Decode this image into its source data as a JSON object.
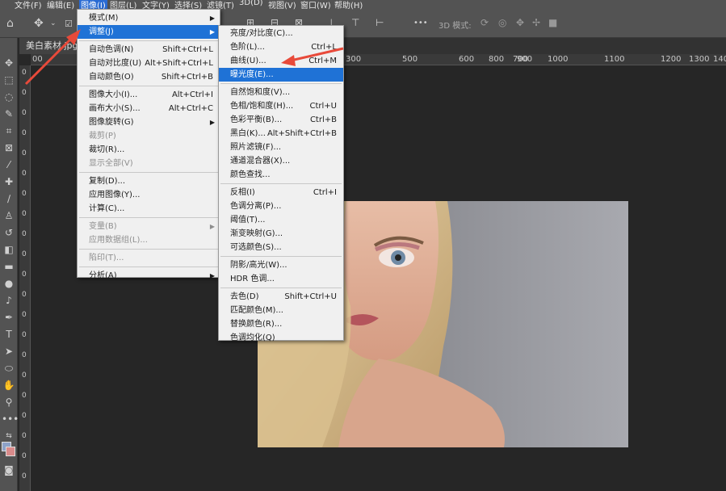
{
  "menubar": {
    "items": [
      "文件(F)",
      "编辑(E)",
      "图像(I)",
      "图层(L)",
      "文字(Y)",
      "选择(S)",
      "滤镜(T)",
      "3D(D)",
      "视图(V)",
      "窗口(W)",
      "帮助(H)"
    ]
  },
  "optbar": {
    "mode_3d": "3D 模式:",
    "dots": "•••"
  },
  "document": {
    "tab_title": "美白素材.jpg"
  },
  "ruler": {
    "top": [
      "00",
      "300",
      "500",
      "600",
      "700",
      "800",
      "900",
      "1000",
      "1100",
      "1200",
      "1300",
      "1400"
    ],
    "left": [
      "0",
      "0",
      "0",
      "0",
      "0",
      "0",
      "0",
      "0",
      "0",
      "0",
      "0",
      "0",
      "0",
      "0",
      "0",
      "0",
      "0",
      "0",
      "0",
      "0",
      "0"
    ]
  },
  "image_menu": {
    "items": [
      {
        "label": "模式(M)",
        "shortcut": "",
        "submenu": true
      },
      {
        "label": "调整(J)",
        "shortcut": "",
        "submenu": true,
        "highlighted": true
      },
      {
        "label": "自动色调(N)",
        "shortcut": "Shift+Ctrl+L"
      },
      {
        "label": "自动对比度(U)",
        "shortcut": "Alt+Shift+Ctrl+L"
      },
      {
        "label": "自动颜色(O)",
        "shortcut": "Shift+Ctrl+B"
      },
      {
        "label": "图像大小(I)...",
        "shortcut": "Alt+Ctrl+I"
      },
      {
        "label": "画布大小(S)...",
        "shortcut": "Alt+Ctrl+C"
      },
      {
        "label": "图像旋转(G)",
        "shortcut": "",
        "submenu": true
      },
      {
        "label": "裁剪(P)",
        "shortcut": "",
        "disabled": true
      },
      {
        "label": "裁切(R)...",
        "shortcut": ""
      },
      {
        "label": "显示全部(V)",
        "shortcut": "",
        "disabled": true
      },
      {
        "label": "复制(D)...",
        "shortcut": ""
      },
      {
        "label": "应用图像(Y)...",
        "shortcut": ""
      },
      {
        "label": "计算(C)...",
        "shortcut": ""
      },
      {
        "label": "变量(B)",
        "shortcut": "",
        "submenu": true,
        "disabled": true
      },
      {
        "label": "应用数据组(L)...",
        "shortcut": "",
        "disabled": true
      },
      {
        "label": "陷印(T)...",
        "shortcut": "",
        "disabled": true
      },
      {
        "label": "分析(A)",
        "shortcut": "",
        "submenu": true
      }
    ]
  },
  "adjust_menu": {
    "items": [
      {
        "label": "亮度/对比度(C)...",
        "shortcut": ""
      },
      {
        "label": "色阶(L)...",
        "shortcut": "Ctrl+L"
      },
      {
        "label": "曲线(U)...",
        "shortcut": "Ctrl+M"
      },
      {
        "label": "曝光度(E)...",
        "shortcut": "",
        "highlighted": true
      },
      {
        "label": "自然饱和度(V)...",
        "shortcut": ""
      },
      {
        "label": "色相/饱和度(H)...",
        "shortcut": "Ctrl+U"
      },
      {
        "label": "色彩平衡(B)...",
        "shortcut": "Ctrl+B"
      },
      {
        "label": "黑白(K)...",
        "shortcut": "Alt+Shift+Ctrl+B"
      },
      {
        "label": "照片滤镜(F)...",
        "shortcut": ""
      },
      {
        "label": "通道混合器(X)...",
        "shortcut": ""
      },
      {
        "label": "颜色查找...",
        "shortcut": ""
      },
      {
        "label": "反相(I)",
        "shortcut": "Ctrl+I"
      },
      {
        "label": "色调分离(P)...",
        "shortcut": ""
      },
      {
        "label": "阈值(T)...",
        "shortcut": ""
      },
      {
        "label": "渐变映射(G)...",
        "shortcut": ""
      },
      {
        "label": "可选颜色(S)...",
        "shortcut": ""
      },
      {
        "label": "阴影/高光(W)...",
        "shortcut": ""
      },
      {
        "label": "HDR 色调...",
        "shortcut": ""
      },
      {
        "label": "去色(D)",
        "shortcut": "Shift+Ctrl+U"
      },
      {
        "label": "匹配颜色(M)...",
        "shortcut": ""
      },
      {
        "label": "替换颜色(R)...",
        "shortcut": ""
      },
      {
        "label": "色调均化(Q)",
        "shortcut": ""
      }
    ]
  },
  "colors": {
    "accent": "#1f72d6",
    "arrow": "#e84a3a",
    "foreground_swatch": "#8da2c8",
    "background_swatch": "#d98b8b"
  }
}
